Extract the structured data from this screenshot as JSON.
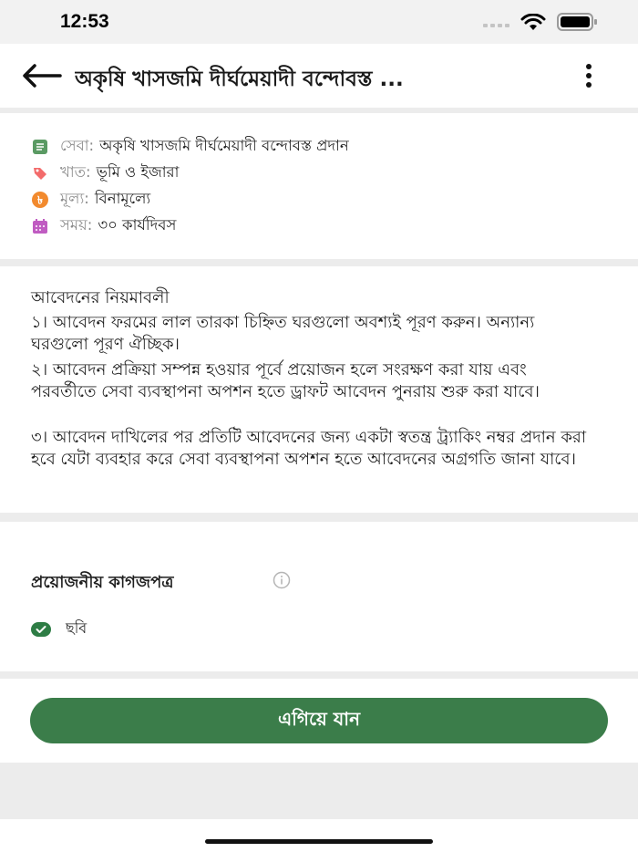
{
  "status_bar": {
    "time": "12:53"
  },
  "app_bar": {
    "title": "অকৃষি খাসজমি দীর্ঘমেয়াদী বন্দোবস্ত ..."
  },
  "info": [
    {
      "label": "সেবা:",
      "value": "অকৃষি খাসজমি দীর্ঘমেয়াদী বন্দোবস্ত প্রদান",
      "icon": "document-list-icon",
      "color": "#5a9a63"
    },
    {
      "label": "খাত:",
      "value": "ভূমি ও ইজারা",
      "icon": "tag-icon",
      "color": "#f36b6b"
    },
    {
      "label": "মূল্য:",
      "value": "বিনামূল্যে",
      "icon": "taka-icon",
      "color": "#f28a2e"
    },
    {
      "label": "সময়:",
      "value": "৩০ কার্যদিবস",
      "icon": "calendar-icon",
      "color": "#c05cc2"
    }
  ],
  "rules": {
    "title": "আবেদনের নিয়মাবলী",
    "items": [
      "১। আবেদন ফরমের লাল তারকা চিহ্নিত ঘরগুলো অবশ্যই পূরণ করুন। অন্যান্য ঘরগুলো পূরণ ঐচ্ছিক।",
      "২। আবেদন প্রক্রিয়া সম্পন্ন হওয়ার পূর্বে প্রয়োজন হলে সংরক্ষণ করা যায় এবং পরবর্তীতে সেবা ব্যবস্থাপনা অপশন হতে ড্রাফট আবেদন পুনরায় শুরু করা যাবে।",
      "৩। আবেদন দাখিলের পর প্রতিটি আবেদনের জন্য একটা স্বতন্ত্র ট্র্যাকিং নম্বর প্রদান করা হবে যেটা ব্যবহার করে সেবা ব্যবস্থাপনা অপশন হতে আবেদনের অগ্রগতি জানা যাবে।"
    ]
  },
  "documents": {
    "title": "প্রয়োজনীয় কাগজপত্র",
    "items": [
      {
        "label": "ছবি"
      }
    ]
  },
  "action": {
    "proceed_label": "এগিয়ে যান"
  },
  "colors": {
    "primary": "#3b7d4a",
    "check": "#2e7d45"
  }
}
